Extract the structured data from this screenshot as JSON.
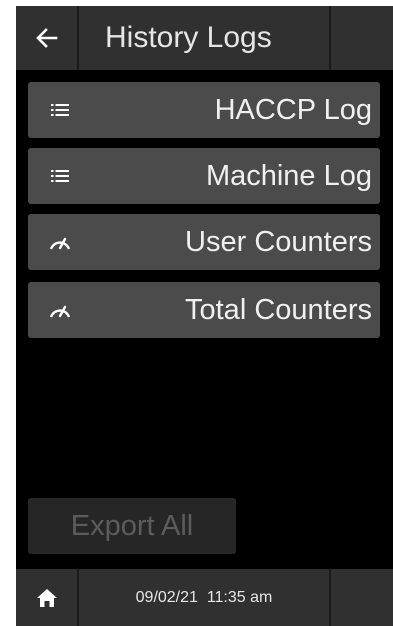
{
  "header": {
    "title": "History Logs",
    "back_icon": "arrow-left-icon"
  },
  "menu": [
    {
      "label": "HACCP Log",
      "icon": "list-icon"
    },
    {
      "label": "Machine Log",
      "icon": "list-icon"
    },
    {
      "label": "User Counters",
      "icon": "gauge-icon"
    },
    {
      "label": "Total Counters",
      "icon": "gauge-icon"
    }
  ],
  "export": {
    "label": "Export All",
    "disabled": true
  },
  "footer": {
    "home_icon": "home-icon",
    "date": "09/02/21",
    "time": "11:35 am"
  },
  "colors": {
    "background": "#000000",
    "bar": "#303030",
    "button": "#4b4b4b",
    "button_disabled": "#262626",
    "text": "#f0f0f0",
    "text_disabled": "#5c5c5c"
  }
}
